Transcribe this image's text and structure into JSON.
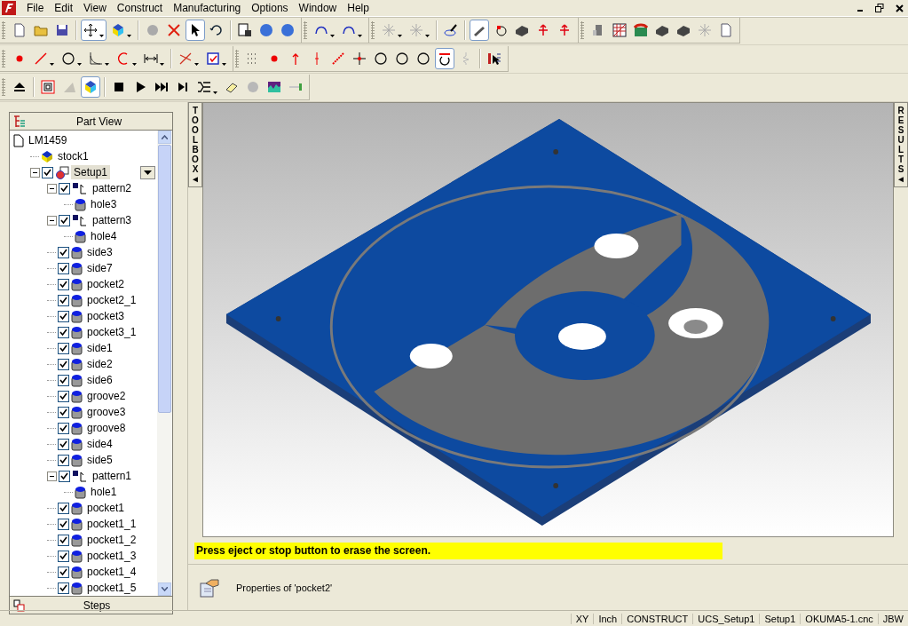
{
  "menu": [
    "File",
    "Edit",
    "View",
    "Construct",
    "Manufacturing",
    "Options",
    "Window",
    "Help"
  ],
  "toolbar_rows": [
    [
      {
        "sections": [
          [
            {
              "selected": false,
              "dropdown": false
            },
            {
              "selected": false,
              "dropdown": false
            },
            {
              "selected": false,
              "dropdown": false
            }
          ],
          [
            {
              "selected": true,
              "dropdown": true
            },
            {
              "selected": false,
              "dropdown": true
            }
          ],
          [
            {
              "selected": false,
              "dropdown": false
            },
            {
              "selected": false,
              "dropdown": false
            },
            {
              "selected": true,
              "dropdown": false
            },
            {
              "selected": false,
              "dropdown": false
            }
          ],
          [
            {
              "selected": false,
              "dropdown": false
            },
            {
              "selected": false,
              "dropdown": false
            },
            {
              "selected": false,
              "dropdown": false
            }
          ]
        ]
      },
      {
        "sections": [
          [
            {
              "selected": false,
              "dropdown": true
            },
            {
              "selected": false,
              "dropdown": true
            }
          ]
        ]
      },
      {
        "sections": [
          [
            {
              "selected": false,
              "dropdown": true
            },
            {
              "selected": false,
              "dropdown": true
            }
          ],
          [
            {
              "selected": false,
              "dropdown": false
            }
          ],
          [
            {
              "selected": true,
              "dropdown": false
            },
            {
              "selected": false,
              "dropdown": false
            },
            {
              "selected": false,
              "dropdown": false
            },
            {
              "selected": false,
              "dropdown": false
            },
            {
              "selected": false,
              "dropdown": false
            }
          ]
        ]
      },
      {
        "sections": [
          [
            {
              "selected": false,
              "dropdown": false
            },
            {
              "selected": false,
              "dropdown": false
            },
            {
              "selected": false,
              "dropdown": false
            },
            {
              "selected": false,
              "dropdown": false
            },
            {
              "selected": false,
              "dropdown": false
            },
            {
              "selected": false,
              "dropdown": false
            },
            {
              "selected": false,
              "dropdown": false
            }
          ]
        ]
      }
    ],
    [
      {
        "sections": [
          [
            {
              "selected": false,
              "dropdown": false
            },
            {
              "selected": false,
              "dropdown": true
            },
            {
              "selected": false,
              "dropdown": true
            },
            {
              "selected": false,
              "dropdown": true
            },
            {
              "selected": false,
              "dropdown": true
            },
            {
              "selected": false,
              "dropdown": true
            }
          ],
          [
            {
              "selected": false,
              "dropdown": true
            },
            {
              "selected": false,
              "dropdown": true
            }
          ]
        ]
      },
      {
        "sections": [
          [
            {
              "selected": false,
              "dropdown": false
            },
            {
              "selected": false,
              "dropdown": false
            },
            {
              "selected": false,
              "dropdown": false
            },
            {
              "selected": false,
              "dropdown": false
            },
            {
              "selected": false,
              "dropdown": false
            },
            {
              "selected": false,
              "dropdown": false
            },
            {
              "selected": false,
              "dropdown": false
            },
            {
              "selected": false,
              "dropdown": false
            },
            {
              "selected": false,
              "dropdown": false
            },
            {
              "selected": true,
              "dropdown": false
            },
            {
              "selected": false,
              "dropdown": false
            }
          ],
          [
            {
              "selected": false,
              "dropdown": false
            }
          ]
        ]
      }
    ],
    [
      {
        "sections": [
          [
            {
              "selected": false,
              "dropdown": false
            }
          ],
          [
            {
              "selected": false,
              "dropdown": false
            },
            {
              "selected": false,
              "dropdown": false
            },
            {
              "selected": true,
              "dropdown": false
            }
          ],
          [
            {
              "selected": false,
              "dropdown": false
            },
            {
              "selected": false,
              "dropdown": false
            },
            {
              "selected": false,
              "dropdown": false
            },
            {
              "selected": false,
              "dropdown": false
            },
            {
              "selected": false,
              "dropdown": true
            },
            {
              "selected": false,
              "dropdown": false
            },
            {
              "selected": false,
              "dropdown": false
            },
            {
              "selected": false,
              "dropdown": false
            },
            {
              "selected": false,
              "dropdown": false
            }
          ]
        ]
      }
    ]
  ],
  "part_view": {
    "title": "Part View",
    "footer_tab": "Steps",
    "tree": [
      {
        "label": "LM1459",
        "kind": "file",
        "selected": false,
        "children": [
          {
            "label": "stock1",
            "kind": "stock",
            "selected": false
          },
          {
            "label": "Setup1",
            "kind": "setup",
            "checked": true,
            "expanded": true,
            "selected": true,
            "children": [
              {
                "label": "pattern2",
                "kind": "pattern",
                "checked": true,
                "expanded": true,
                "selected": false,
                "children": [
                  {
                    "label": "hole3",
                    "kind": "feature",
                    "selected": false
                  }
                ]
              },
              {
                "label": "pattern3",
                "kind": "pattern",
                "checked": true,
                "expanded": true,
                "selected": false,
                "children": [
                  {
                    "label": "hole4",
                    "kind": "feature",
                    "selected": false
                  }
                ]
              },
              {
                "label": "side3",
                "kind": "feature",
                "checked": true,
                "selected": false
              },
              {
                "label": "side7",
                "kind": "feature",
                "checked": true,
                "selected": false
              },
              {
                "label": "pocket2",
                "kind": "feature",
                "checked": true,
                "selected": false
              },
              {
                "label": "pocket2_1",
                "kind": "feature",
                "checked": true,
                "selected": false
              },
              {
                "label": "pocket3",
                "kind": "feature",
                "checked": true,
                "selected": false
              },
              {
                "label": "pocket3_1",
                "kind": "feature",
                "checked": true,
                "selected": false
              },
              {
                "label": "side1",
                "kind": "feature",
                "checked": true,
                "selected": false
              },
              {
                "label": "side2",
                "kind": "feature",
                "checked": true,
                "selected": false
              },
              {
                "label": "side6",
                "kind": "feature",
                "checked": true,
                "selected": false
              },
              {
                "label": "groove2",
                "kind": "feature",
                "checked": true,
                "selected": false
              },
              {
                "label": "groove3",
                "kind": "feature",
                "checked": true,
                "selected": false
              },
              {
                "label": "groove8",
                "kind": "feature",
                "checked": true,
                "selected": false
              },
              {
                "label": "side4",
                "kind": "feature",
                "checked": true,
                "selected": false
              },
              {
                "label": "side5",
                "kind": "feature",
                "checked": true,
                "selected": false
              },
              {
                "label": "pattern1",
                "kind": "pattern",
                "checked": true,
                "expanded": true,
                "selected": false,
                "children": [
                  {
                    "label": "hole1",
                    "kind": "feature",
                    "selected": false
                  }
                ]
              },
              {
                "label": "pocket1",
                "kind": "feature",
                "checked": true,
                "selected": false
              },
              {
                "label": "pocket1_1",
                "kind": "feature",
                "checked": true,
                "selected": false
              },
              {
                "label": "pocket1_2",
                "kind": "feature",
                "checked": true,
                "selected": false
              },
              {
                "label": "pocket1_3",
                "kind": "feature",
                "checked": true,
                "selected": false
              },
              {
                "label": "pocket1_4",
                "kind": "feature",
                "checked": true,
                "selected": false
              },
              {
                "label": "pocket1_5",
                "kind": "feature",
                "checked": true,
                "selected": false
              }
            ]
          }
        ]
      }
    ]
  },
  "side_tabs": {
    "left": {
      "label": "TOOLBOX",
      "arrow": "◄"
    },
    "right": {
      "label": "RESULTS",
      "arrow": "◄"
    }
  },
  "message": "Press eject or stop button to erase the screen.",
  "properties": "Properties of 'pocket2'",
  "status_bar": [
    "XY",
    "Inch",
    "CONSTRUCT",
    "UCS_Setup1",
    "Setup1",
    "OKUMA5-1.cnc",
    "JBW"
  ]
}
